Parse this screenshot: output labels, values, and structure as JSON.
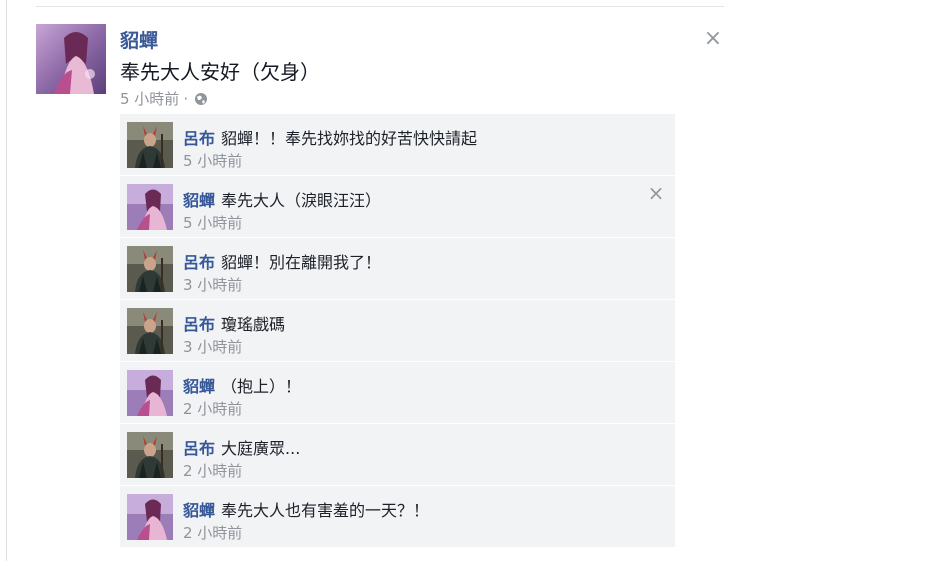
{
  "post": {
    "author": "貂蟬",
    "text": "奉先大人安好（欠身）",
    "time": "5 小時前",
    "separator": "·",
    "close_icon": "close-icon",
    "globe_icon": "globe-icon"
  },
  "comments": [
    {
      "author": "呂布",
      "text": "貂蟬！！奉先找妳找的好苦快快請起",
      "time": "5 小時前",
      "avatar": "lubu-avatar"
    },
    {
      "author": "貂蟬",
      "text": "奉先大人（淚眼汪汪）",
      "time": "5 小時前",
      "avatar": "diaochan-avatar",
      "close": "×"
    },
    {
      "author": "呂布",
      "text": "貂蟬！別在離開我了！",
      "time": "3 小時前",
      "avatar": "lubu-avatar"
    },
    {
      "author": "呂布",
      "text": "瓊瑤戲碼",
      "time": "3 小時前",
      "avatar": "lubu-avatar"
    },
    {
      "author": "貂蟬",
      "text": "（抱上）！",
      "time": "2 小時前",
      "avatar": "diaochan-avatar"
    },
    {
      "author": "呂布",
      "text": "大庭廣眾...",
      "time": "2 小時前",
      "avatar": "lubu-avatar"
    },
    {
      "author": "貂蟬",
      "text": "奉先大人也有害羞的一天？！",
      "time": "2 小時前",
      "avatar": "diaochan-avatar"
    }
  ],
  "post_close_label": "×",
  "colors": {
    "link": "#365899",
    "meta": "#90949c",
    "comment_bg": "#f2f3f5"
  }
}
